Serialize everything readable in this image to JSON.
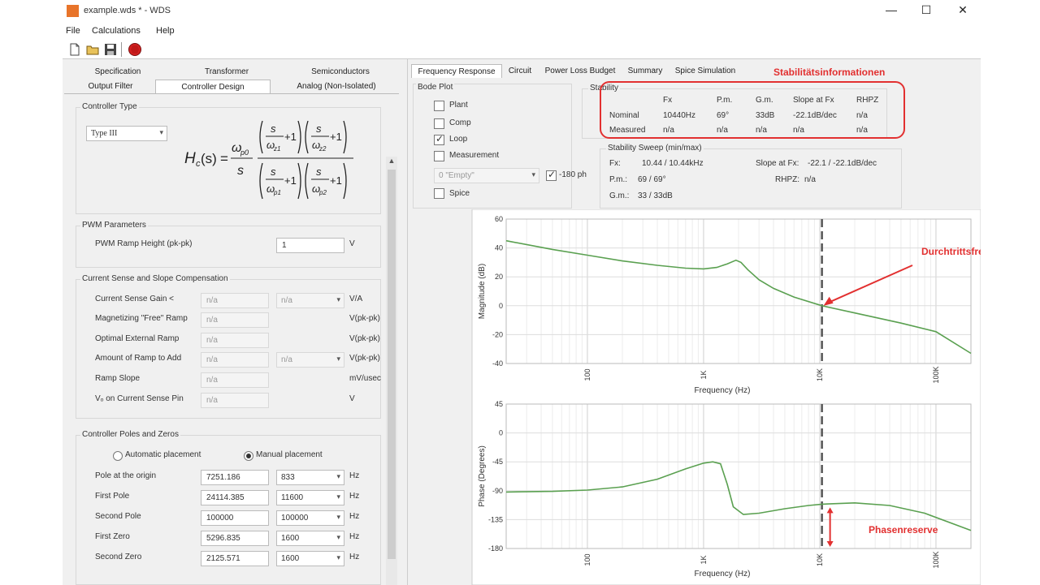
{
  "window": {
    "title": "example.wds * - WDS",
    "minimize": "—",
    "maximize": "☐",
    "close": "✕"
  },
  "menu": {
    "file": "File",
    "calculations": "Calculations",
    "help": "Help"
  },
  "toolbar": {
    "icons": [
      "new-file-icon",
      "open-folder-icon",
      "save-icon",
      "stop-icon"
    ]
  },
  "left_tabs": {
    "row1": [
      "Specification",
      "Transformer",
      "Semiconductors"
    ],
    "row2": [
      "Output Filter",
      "Controller Design",
      "Analog (Non-Isolated)"
    ]
  },
  "controller_type": {
    "title": "Controller Type",
    "type_value": "Type III",
    "formula": {
      "lhs": "H",
      "lhs_sub": "c",
      "lhs_arg": "(s)",
      "eq": "=",
      "num_lead": "ω",
      "num_lead_sub": "p0",
      "den_lead": "s",
      "s": "s",
      "z1": "ω",
      "z1_sub": "z1",
      "z2_sub": "z2",
      "p1_sub": "p1",
      "p2_sub": "p2",
      "plus1": "+1"
    }
  },
  "pwm": {
    "title": "PWM Parameters",
    "ramp_label": "PWM Ramp Height (pk-pk)",
    "ramp_value": "1",
    "ramp_unit": "V"
  },
  "current_sense": {
    "title": "Current Sense and Slope Compensation",
    "rows": [
      {
        "label": "Current Sense Gain <",
        "value": "n/a",
        "combo": "n/a",
        "unit": "V/A"
      },
      {
        "label": "Magnetizing \"Free\" Ramp",
        "value": "n/a",
        "combo": "",
        "unit": "V(pk-pk)"
      },
      {
        "label": "Optimal External Ramp",
        "value": "n/a",
        "combo": "",
        "unit": "V(pk-pk)"
      },
      {
        "label": "Amount of Ramp to Add",
        "value": "n/a",
        "combo": "n/a",
        "unit": "V(pk-pk)"
      },
      {
        "label": "Ramp Slope",
        "value": "n/a",
        "combo": "",
        "unit": "mV/usec"
      },
      {
        "label": "Vₒ on Current Sense Pin",
        "value": "n/a",
        "combo": "",
        "unit": "V"
      }
    ]
  },
  "poles_zeros": {
    "title": "Controller Poles and Zeros",
    "auto_label": "Automatic placement",
    "manual_label": "Manual placement",
    "rows": [
      {
        "label": "Pole at the origin",
        "value": "7251.186",
        "combo": "833",
        "unit": "Hz"
      },
      {
        "label": "First Pole",
        "value": "24114.385",
        "combo": "11600",
        "unit": "Hz"
      },
      {
        "label": "Second Pole",
        "value": "100000",
        "combo": "100000",
        "unit": "Hz"
      },
      {
        "label": "First Zero",
        "value": "5296.835",
        "combo": "1600",
        "unit": "Hz"
      },
      {
        "label": "Second Zero",
        "value": "2125.571",
        "combo": "1600",
        "unit": "Hz"
      }
    ]
  },
  "right_tabs": [
    "Frequency Response",
    "Circuit",
    "Power Loss Budget",
    "Summary",
    "Spice Simulation"
  ],
  "annotations": {
    "stability_info": "Stabilitätsinformationen",
    "crossover": "Durchtrittsfrequenz",
    "phase_margin": "Phasenreserve"
  },
  "bode_plot": {
    "title": "Bode Plot",
    "plant": "Plant",
    "comp": "Comp",
    "loop": "Loop",
    "measurement": "Measurement",
    "spice": "Spice",
    "measurement_combo": "0 \"Empty\"",
    "minus180": "-180 ph",
    "checked": {
      "plant": false,
      "comp": false,
      "loop": true,
      "measurement": false,
      "spice": false,
      "minus180": true
    }
  },
  "stability": {
    "title": "Stability",
    "headers": [
      "Fx",
      "P.m.",
      "G.m.",
      "Slope at Fx",
      "RHPZ"
    ],
    "rows": [
      {
        "name": "Nominal",
        "cells": [
          "10440Hz",
          "69°",
          "33dB",
          "-22.1dB/dec",
          "n/a"
        ]
      },
      {
        "name": "Measured",
        "cells": [
          "n/a",
          "n/a",
          "n/a",
          "n/a",
          "n/a"
        ]
      }
    ]
  },
  "sweep": {
    "title": "Stability Sweep (min/max)",
    "fx_label": "Fx:",
    "fx_value": "10.44 / 10.44kHz",
    "pm_label": "P.m.:",
    "pm_value": "69 / 69°",
    "gm_label": "G.m.:",
    "gm_value": "33 / 33dB",
    "slope_label": "Slope at Fx:",
    "slope_value": "-22.1 / -22.1dB/dec",
    "rhpz_label": "RHPZ:",
    "rhpz_value": "n/a"
  },
  "chart_data": [
    {
      "type": "line",
      "xlabel": "Frequency (Hz)",
      "ylabel": "Magnitude (dB)",
      "x_scale": "log",
      "xlim": [
        20,
        200000
      ],
      "ylim": [
        -40,
        60
      ],
      "y_ticks": [
        "60",
        "40",
        "20",
        "0",
        "-20",
        "-40"
      ],
      "x_ticks": [
        {
          "v": 100,
          "label": "100"
        },
        {
          "v": 1000,
          "label": "1K"
        },
        {
          "v": 10000,
          "label": "10K"
        },
        {
          "v": 100000,
          "label": "100K"
        }
      ],
      "crossover_hz": 10440,
      "grid": true,
      "series": [
        {
          "color": "#5aa050",
          "points": [
            [
              20,
              45
            ],
            [
              50,
              39
            ],
            [
              100,
              35
            ],
            [
              200,
              31
            ],
            [
              400,
              28
            ],
            [
              700,
              26
            ],
            [
              1000,
              25.5
            ],
            [
              1300,
              26.5
            ],
            [
              1600,
              29
            ],
            [
              1900,
              31.5
            ],
            [
              2100,
              30
            ],
            [
              2400,
              25
            ],
            [
              3000,
              18
            ],
            [
              4000,
              12
            ],
            [
              6000,
              6
            ],
            [
              10440,
              0
            ],
            [
              20000,
              -5
            ],
            [
              50000,
              -12
            ],
            [
              100000,
              -18
            ],
            [
              200000,
              -33
            ]
          ]
        }
      ]
    },
    {
      "type": "line",
      "xlabel": "Frequency (Hz)",
      "ylabel": "Phase (Degrees)",
      "x_scale": "log",
      "xlim": [
        20,
        200000
      ],
      "ylim": [
        -180,
        45
      ],
      "y_ticks": [
        "45",
        "0",
        "-45",
        "-90",
        "-135",
        "-180"
      ],
      "x_ticks": [
        {
          "v": 100,
          "label": "100"
        },
        {
          "v": 1000,
          "label": "1K"
        },
        {
          "v": 10000,
          "label": "10K"
        },
        {
          "v": 100000,
          "label": "100K"
        }
      ],
      "crossover_hz": 10440,
      "grid": true,
      "series": [
        {
          "color": "#5aa050",
          "points": [
            [
              20,
              -92
            ],
            [
              50,
              -91
            ],
            [
              100,
              -89
            ],
            [
              200,
              -84
            ],
            [
              400,
              -72
            ],
            [
              700,
              -56
            ],
            [
              1000,
              -47
            ],
            [
              1200,
              -45
            ],
            [
              1400,
              -48
            ],
            [
              1600,
              -80
            ],
            [
              1800,
              -115
            ],
            [
              2200,
              -127
            ],
            [
              3000,
              -125
            ],
            [
              5000,
              -118
            ],
            [
              8000,
              -113
            ],
            [
              10440,
              -111
            ],
            [
              20000,
              -109
            ],
            [
              40000,
              -113
            ],
            [
              80000,
              -125
            ],
            [
              200000,
              -152
            ]
          ]
        }
      ]
    }
  ]
}
